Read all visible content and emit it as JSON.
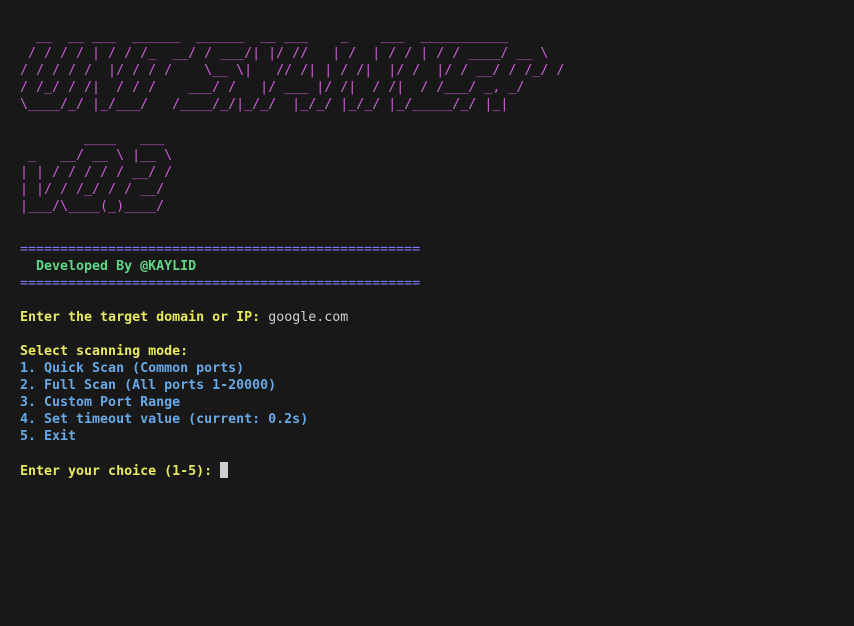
{
  "banner": {
    "title_art": "  __  __ ___  ______  ______  __ ___    _    ___  ___________\n / / / / | / / /_  __/ / ___/| |/ //   | /  | / / | / / ____/ __ \\\n/ / / / /  |/ / / /    \\__ \\|   // /| | / /|  |/ /  |/ / __/ / /_/ /\n/ /_/ / /|  / / /    ___/ /   |/ ___ |/ /|  / /|  / /___/ _, _/\n\\____/_/ |_/___/   /____/_/|_/_/  |_/_/ |_/_/ |_/_____/_/ |_|",
    "version_art": "        ____   ___\n _   __/ __ \\ |__ \\\n| | / / / / / __/ /\n| |/ / /_/ / / __/\n|___/\\____(_)____/"
  },
  "rule": "==================================================",
  "credit": "  Developed By @KAYLID",
  "target": {
    "prompt": "Enter the target domain or IP:",
    "value": "google.com"
  },
  "menu": {
    "heading": "Select scanning mode:",
    "items": [
      "1. Quick Scan (Common ports)",
      "2. Full Scan (All ports 1-20000)",
      "3. Custom Port Range",
      "4. Set timeout value (current: 0.2s)",
      "5. Exit"
    ]
  },
  "choice": {
    "prompt": "Enter your choice (1-5):"
  },
  "colors": {
    "background": "#181818",
    "banner": "#d05ed8",
    "rule": "#7b7bf5",
    "credit": "#5fd787",
    "prompt": "#e7e95f",
    "menu": "#67a9e6"
  }
}
